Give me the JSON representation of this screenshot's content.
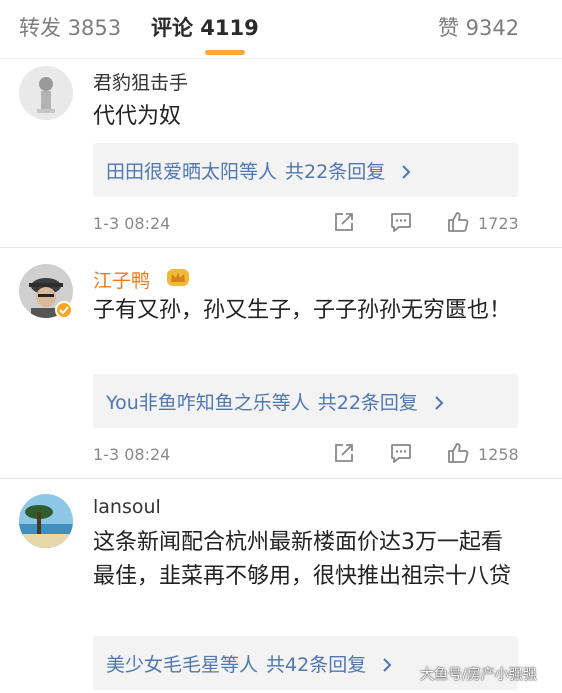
{
  "tabs": {
    "repost_label": "转发 3853",
    "comments_label": "评论 4119",
    "likes_label": "赞 9342"
  },
  "comments": [
    {
      "username": "君豹狙击手",
      "text": "代代为奴",
      "reply_summary": "田田很爱晒太阳等人",
      "reply_count": "共22条回复",
      "time": "1-3 08:24",
      "like_count": "1723"
    },
    {
      "username": "江子鸭",
      "text": "子有又孙，孙又生子，子子孙孙无穷匮也！",
      "reply_summary": "You非鱼咋知鱼之乐等人",
      "reply_count": "共22条回复",
      "time": "1-3 08:24",
      "like_count": "1258"
    },
    {
      "username": "lansoul",
      "text": "这条新闻配合杭州最新楼面价达3万一起看最佳，韭菜再不够用，很快推出祖宗十八贷",
      "reply_summary": "美少女毛毛星等人",
      "reply_count": "共42条回复",
      "time": "",
      "like_count": ""
    }
  ],
  "watermark": "大鱼号/房产小强强",
  "icons": {
    "repost": "repost-icon",
    "comment": "comment-icon",
    "like": "thumbs-up-icon",
    "chevron": "chevron-right-icon"
  },
  "colors": {
    "accent": "#f7a93b",
    "link": "#4f77b0",
    "vip_name": "#e87b1c"
  }
}
